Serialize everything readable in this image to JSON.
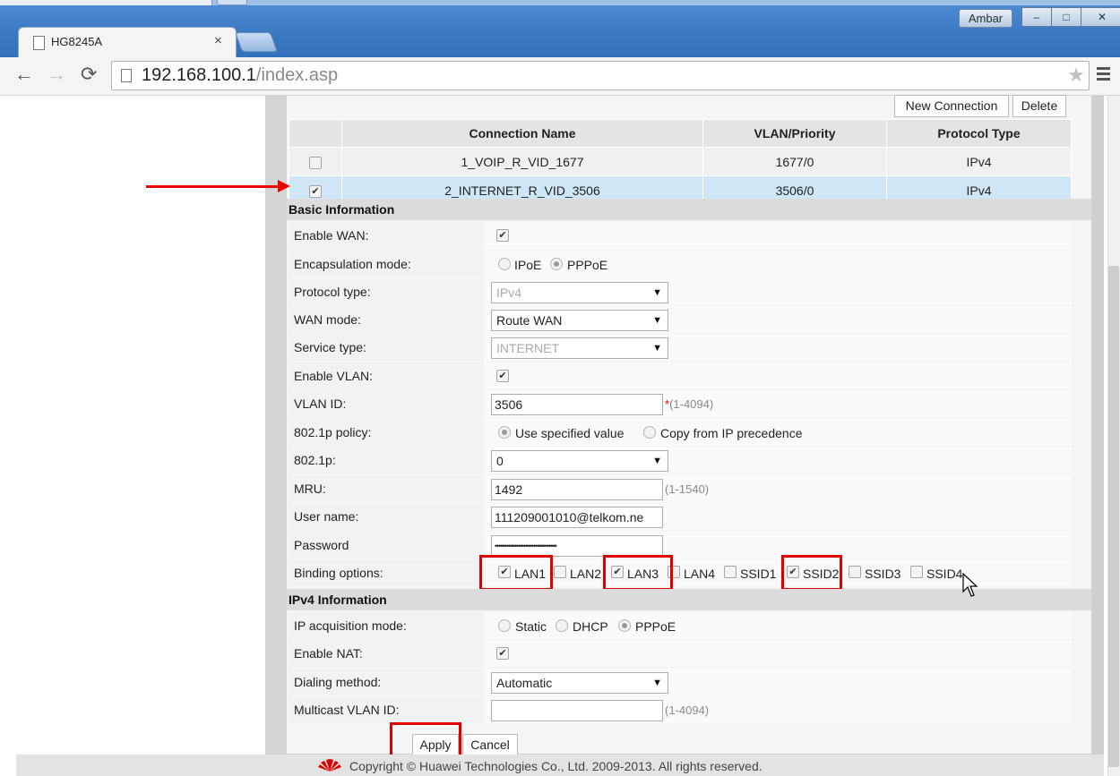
{
  "window": {
    "user_badge": "Ambar",
    "minimize": "–",
    "maximize": "□",
    "close": "✕"
  },
  "tab": {
    "title": "HG8245A",
    "close": "×"
  },
  "address": {
    "host": "192.168.100.1",
    "path": "/index.asp"
  },
  "actions": {
    "new_connection": "New Connection",
    "delete": "Delete"
  },
  "connections": {
    "headers": [
      "Connection Name",
      "VLAN/Priority",
      "Protocol Type"
    ],
    "rows": [
      {
        "name": "1_VOIP_R_VID_1677",
        "vlan": "1677/0",
        "protocol": "IPv4",
        "checked": false
      },
      {
        "name": "2_INTERNET_R_VID_3506",
        "vlan": "3506/0",
        "protocol": "IPv4",
        "checked": true
      }
    ]
  },
  "basic": {
    "title": "Basic Information",
    "enable_wan": "Enable WAN:",
    "encapsulation": {
      "label": "Encapsulation mode:",
      "opt1": "IPoE",
      "opt2": "PPPoE"
    },
    "protocol_type": {
      "label": "Protocol type:",
      "value": "IPv4"
    },
    "wan_mode": {
      "label": "WAN mode:",
      "value": "Route WAN"
    },
    "service_type": {
      "label": "Service type:",
      "value": "INTERNET"
    },
    "enable_vlan": "Enable VLAN:",
    "vlan_id": {
      "label": "VLAN ID:",
      "value": "3506",
      "req": "*",
      "hint": "(1-4094)"
    },
    "policy": {
      "label": "802.1p policy:",
      "opt1": "Use specified value",
      "opt2": "Copy from IP precedence"
    },
    "p8021": {
      "label": "802.1p:",
      "value": "0"
    },
    "mru": {
      "label": "MRU:",
      "value": "1492",
      "hint": "(1-1540)"
    },
    "username": {
      "label": "User name:",
      "value": "111209001010@telkom.ne"
    },
    "password": {
      "label": "Password",
      "value": "••••••••••••••••••••••••••••••••"
    },
    "binding": {
      "label": "Binding options:",
      "lan1": "LAN1",
      "lan2": "LAN2",
      "lan3": "LAN3",
      "lan4": "LAN4",
      "ssid1": "SSID1",
      "ssid2": "SSID2",
      "ssid3": "SSID3",
      "ssid4": "SSID4"
    }
  },
  "ipv4": {
    "title": "IPv4 Information",
    "acq": {
      "label": "IP acquisition mode:",
      "opt1": "Static",
      "opt2": "DHCP",
      "opt3": "PPPoE"
    },
    "nat": "Enable NAT:",
    "dialing": {
      "label": "Dialing method:",
      "value": "Automatic"
    },
    "multicast": {
      "label": "Multicast VLAN ID:",
      "hint": "(1-4094)"
    }
  },
  "buttons": {
    "apply": "Apply",
    "cancel": "Cancel"
  },
  "footer": {
    "copyright": "Copyright © Huawei Technologies Co., Ltd. 2009-2013. All rights reserved."
  },
  "colors": {
    "accent_red": "#e10000",
    "selected_row": "#cfe6f7",
    "title_blue": "#3a78c2"
  }
}
